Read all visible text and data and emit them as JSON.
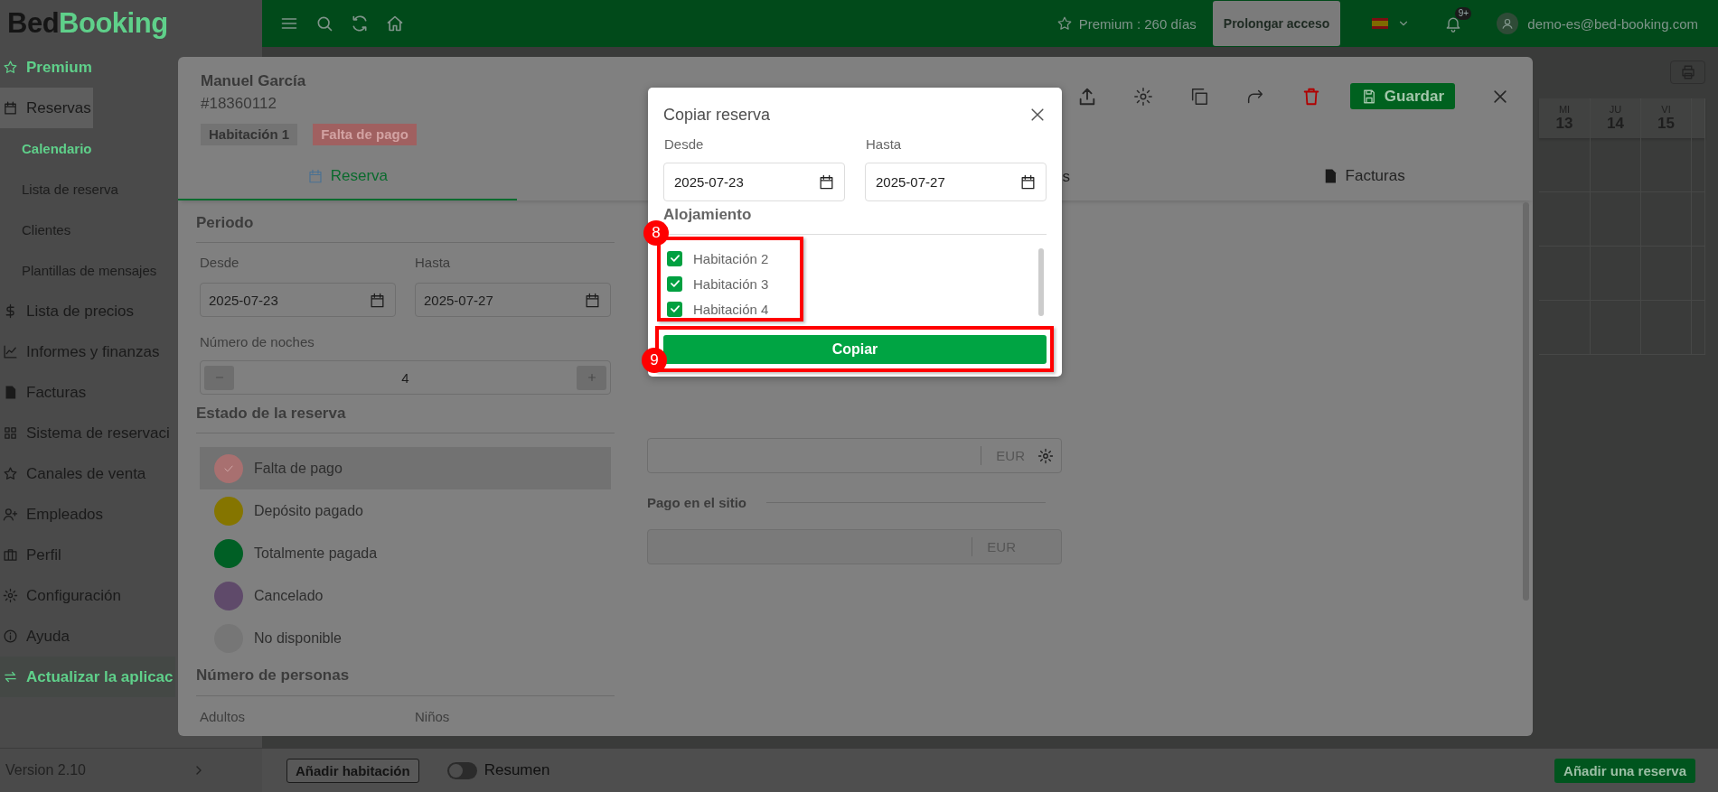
{
  "logo": {
    "first": "Bed",
    "second": "Booking"
  },
  "topbar": {
    "premium": "Premium : 260 días",
    "extend_button": "Prolongar acceso",
    "notifications_badge": "9+",
    "user": "demo-es@bed-booking.com"
  },
  "sidebar": {
    "items": [
      {
        "label": "Premium",
        "kind": "promo",
        "selected": false
      },
      {
        "label": "Reservas",
        "kind": "normal",
        "selected": false,
        "expanded": true,
        "children": [
          {
            "label": "Calendario",
            "selected": true
          },
          {
            "label": "Lista de reserva",
            "selected": false
          },
          {
            "label": "Clientes",
            "selected": false
          },
          {
            "label": "Plantillas de mensajes",
            "selected": false
          }
        ]
      },
      {
        "label": "Lista de precios",
        "kind": "normal",
        "selected": false
      },
      {
        "label": "Informes y finanzas",
        "kind": "normal",
        "selected": false
      },
      {
        "label": "Facturas",
        "kind": "normal",
        "selected": false
      },
      {
        "label": "Sistema de reservaci",
        "kind": "normal",
        "selected": false
      },
      {
        "label": "Canales de venta",
        "kind": "normal",
        "selected": false
      },
      {
        "label": "Empleados",
        "kind": "normal",
        "selected": false
      },
      {
        "label": "Perfil",
        "kind": "normal",
        "selected": false
      },
      {
        "label": "Configuración",
        "kind": "normal",
        "selected": false
      },
      {
        "label": "Ayuda",
        "kind": "normal",
        "selected": false
      },
      {
        "label": "Actualizar la aplicac",
        "kind": "update",
        "selected": false
      }
    ],
    "version": "Version 2.10"
  },
  "calendar": {
    "days": [
      {
        "weekday": "MI",
        "day": "13"
      },
      {
        "weekday": "JU",
        "day": "14"
      },
      {
        "weekday": "VI",
        "day": "15"
      }
    ]
  },
  "booking": {
    "guest": "Manuel García",
    "number": "#18360112",
    "tags": [
      {
        "label": "Habitación 1",
        "kind": "room"
      },
      {
        "label": "Falta de pago",
        "kind": "status"
      }
    ],
    "save_button": "Guardar",
    "tabs": [
      {
        "label": "Reserva",
        "selected": true
      },
      {
        "label": "s",
        "selected": false
      },
      {
        "label": "Facturas",
        "selected": false
      }
    ],
    "period": {
      "title": "Periodo",
      "from_label": "Desde",
      "from": "2025-07-23",
      "to_label": "Hasta",
      "to": "2025-07-27",
      "nights_label": "Número de noches",
      "nights": "4"
    },
    "status": {
      "title": "Estado de la reserva",
      "options": [
        {
          "label": "Falta de pago",
          "color": "#a87070",
          "selected": true
        },
        {
          "label": "Depósito pagado",
          "color": "#857500",
          "selected": false
        },
        {
          "label": "Totalmente pagada",
          "color": "#005f25",
          "selected": false
        },
        {
          "label": "Cancelado",
          "color": "#5f4a6a",
          "selected": false
        },
        {
          "label": "No disponible",
          "color": "#767676",
          "selected": false
        }
      ]
    },
    "persons": {
      "title": "Número de personas",
      "adults_label": "Adultos",
      "children_label": "Niños"
    },
    "payment": {
      "currency": "EUR",
      "onsite_title": "Pago en el sitio",
      "onsite_currency": "EUR"
    }
  },
  "copy_dialog": {
    "title": "Copiar reserva",
    "from_label": "Desde",
    "from": "2025-07-23",
    "to_label": "Hasta",
    "to": "2025-07-27",
    "accommodation_title": "Alojamiento",
    "rooms": [
      {
        "label": "Habitación 2",
        "checked": true
      },
      {
        "label": "Habitación 3",
        "checked": true
      },
      {
        "label": "Habitación 4",
        "checked": true
      }
    ],
    "copy_button": "Copiar"
  },
  "annotations": [
    {
      "number": "8"
    },
    {
      "number": "9"
    }
  ],
  "bottom_bar": {
    "add_room_button": "Añadir habitación",
    "summary_toggle": {
      "label": "Resumen",
      "on": false
    },
    "add_booking_button": "Añadir una reserva"
  }
}
